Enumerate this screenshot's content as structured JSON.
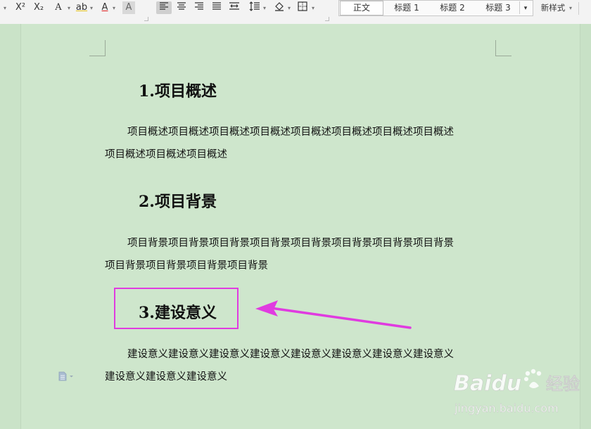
{
  "toolbar": {
    "buttons": [
      {
        "name": "superscript-button",
        "label": "X²"
      },
      {
        "name": "subscript-button",
        "label": "X₂"
      },
      {
        "name": "text-effect-button",
        "label": "A"
      },
      {
        "name": "highlight-button",
        "label": "ab"
      },
      {
        "name": "font-color-button",
        "label": "A"
      },
      {
        "name": "char-shading-button",
        "label": "A"
      }
    ],
    "styles": {
      "zhengwen": "正文",
      "h1": "标题 1",
      "h2": "标题 2",
      "h3": "标题 3",
      "new_style": "新样式"
    }
  },
  "document": {
    "sections": [
      {
        "heading": "1.项目概述",
        "line1": "项目概述项目概述项目概述项目概述项目概述项目概述项目概述项目概述",
        "line2": "项目概述项目概述项目概述"
      },
      {
        "heading": "2.项目背景",
        "line1": "项目背景项目背景项目背景项目背景项目背景项目背景项目背景项目背景",
        "line2": "项目背景项目背景项目背景项目背景"
      },
      {
        "heading": "3.建设意义",
        "line1": "建设意义建设意义建设意义建设意义建设意义建设意义建设意义建设意义",
        "line2": "建设意义建设意义建设意义"
      }
    ]
  },
  "colors": {
    "page_bg": "#cee6cc",
    "annotation": "#e03be0"
  },
  "watermark": {
    "brand": "Baidu",
    "product": "经验",
    "url": "jingyan.baidu.com"
  }
}
